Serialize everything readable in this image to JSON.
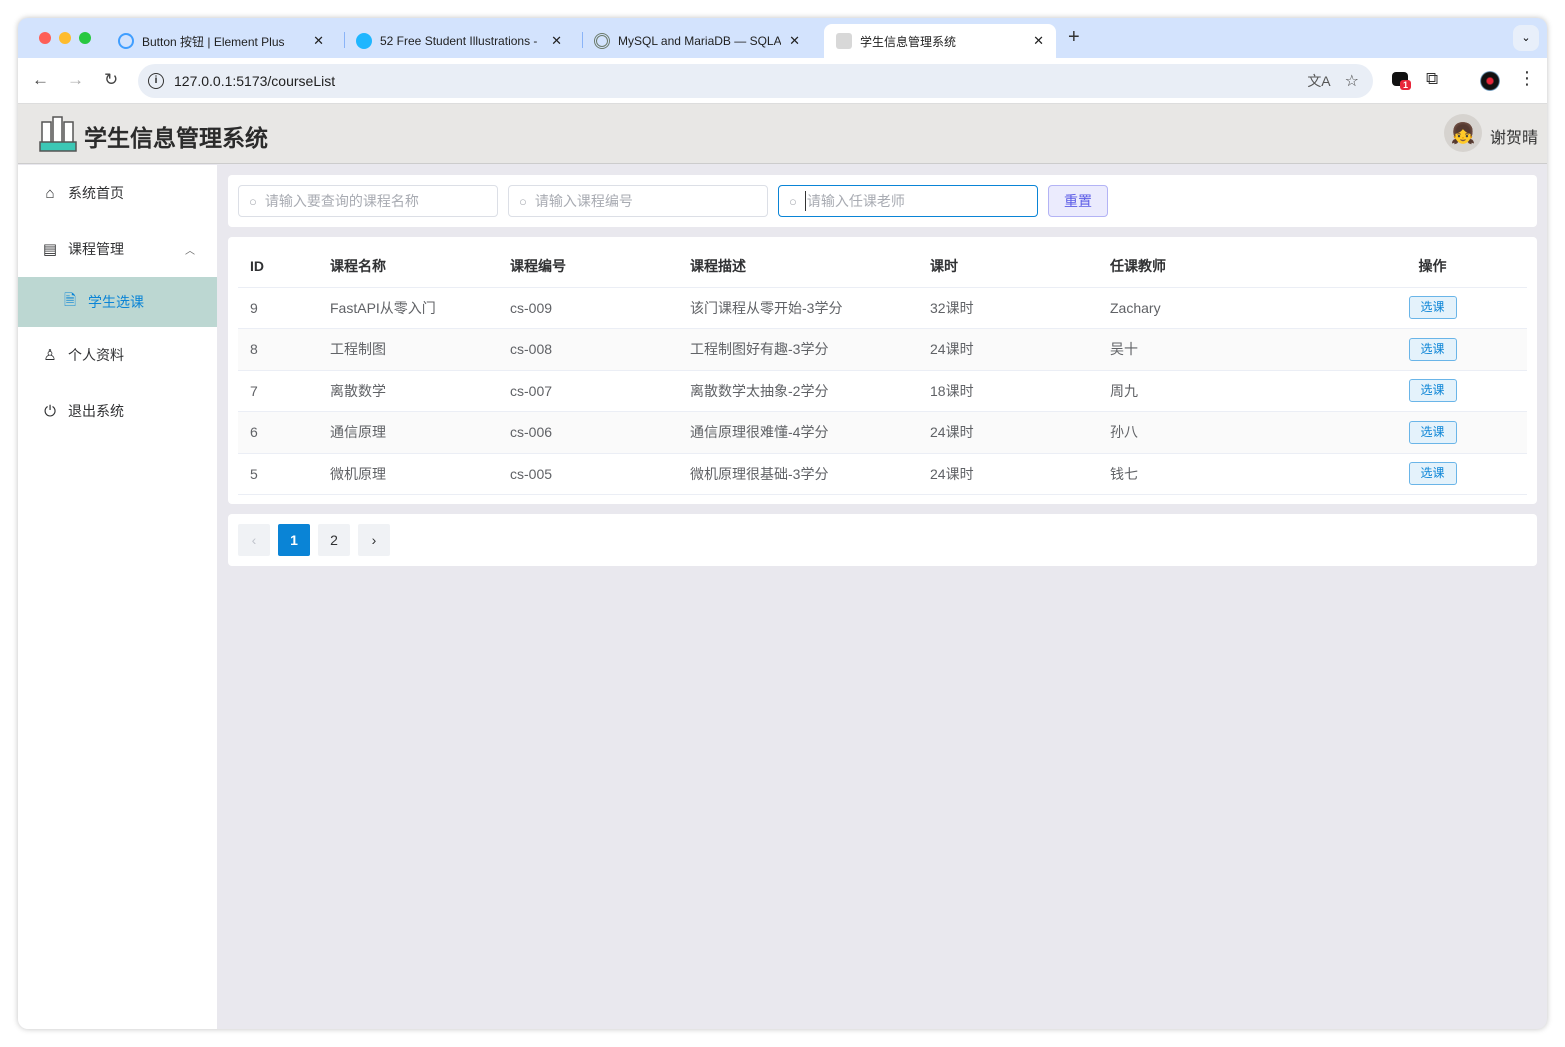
{
  "browser": {
    "tabs": [
      {
        "title": "Button 按钮 | Element Plus",
        "icon": "element-plus-icon",
        "color": "#409eff"
      },
      {
        "title": "52 Free Student Illustrations -",
        "icon": "search-logo-icon",
        "color": "#1fb6ff"
      },
      {
        "title": "MySQL and MariaDB — SQLA",
        "icon": "sqlalchemy-icon",
        "color": "#6b7b6b"
      },
      {
        "title": "学生信息管理系统",
        "icon": "student-icon",
        "color": "#555"
      }
    ],
    "url": "127.0.0.1:5173/courseList",
    "extension_badge": "1",
    "new_tab": "+"
  },
  "app": {
    "title": "学生信息管理系统",
    "user": "谢贺晴"
  },
  "sidebar": {
    "items": [
      {
        "label": "系统首页",
        "icon": "home-icon"
      },
      {
        "label": "课程管理",
        "icon": "document-list-icon"
      },
      {
        "label": "学生选课",
        "icon": "document-icon",
        "active": true
      },
      {
        "label": "个人资料",
        "icon": "user-icon"
      },
      {
        "label": "退出系统",
        "icon": "power-icon"
      }
    ]
  },
  "search": {
    "name_placeholder": "请输入要查询的课程名称",
    "code_placeholder": "请输入课程编号",
    "teacher_placeholder": "请输入任课老师",
    "reset_label": "重置"
  },
  "table": {
    "headers": [
      "ID",
      "课程名称",
      "课程编号",
      "课程描述",
      "课时",
      "任课教师",
      "操作"
    ],
    "action_label": "选课",
    "rows": [
      [
        "9",
        "FastAPI从零入门",
        "cs-009",
        "该门课程从零开始-3学分",
        "32课时",
        "Zachary"
      ],
      [
        "8",
        "工程制图",
        "cs-008",
        "工程制图好有趣-3学分",
        "24课时",
        "吴十"
      ],
      [
        "7",
        "离散数学",
        "cs-007",
        "离散数学太抽象-2学分",
        "18课时",
        "周九"
      ],
      [
        "6",
        "通信原理",
        "cs-006",
        "通信原理很难懂-4学分",
        "24课时",
        "孙八"
      ],
      [
        "5",
        "微机原理",
        "cs-005",
        "微机原理很基础-3学分",
        "24课时",
        "钱七"
      ]
    ]
  },
  "pagination": {
    "prev": "‹",
    "pages": [
      "1",
      "2"
    ],
    "current": "1",
    "next": "›"
  },
  "colors": {
    "accent": "#0a84d6",
    "active_menu_bg": "#bcd7d2",
    "header_bg": "#e8e7e5"
  }
}
